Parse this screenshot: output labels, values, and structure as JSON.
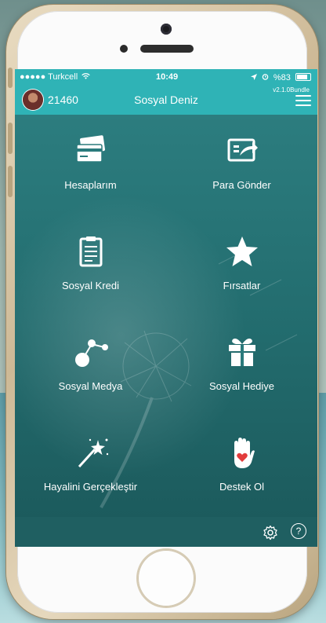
{
  "status_bar": {
    "carrier": "●●●●● Turkcell",
    "time": "10:49",
    "battery": "%83"
  },
  "header": {
    "points": "21460",
    "title": "Sosyal Deniz",
    "version": "v2.1.0Bundle"
  },
  "tiles": [
    {
      "label": "Hesaplarım",
      "icon": "cards-icon"
    },
    {
      "label": "Para Gönder",
      "icon": "send-money-icon"
    },
    {
      "label": "Sosyal Kredi",
      "icon": "clipboard-icon"
    },
    {
      "label": "Fırsatlar",
      "icon": "star-icon"
    },
    {
      "label": "Sosyal Medya",
      "icon": "share-icon"
    },
    {
      "label": "Sosyal Hediye",
      "icon": "gift-icon"
    },
    {
      "label": "Hayalini Gerçekleştir",
      "icon": "magic-wand-icon"
    },
    {
      "label": "Destek Ol",
      "icon": "heart-hand-icon"
    }
  ],
  "bottom": {
    "help_symbol": "?"
  },
  "colors": {
    "header": "#2fb3b6",
    "grid_dark": "#1c5b5d"
  }
}
